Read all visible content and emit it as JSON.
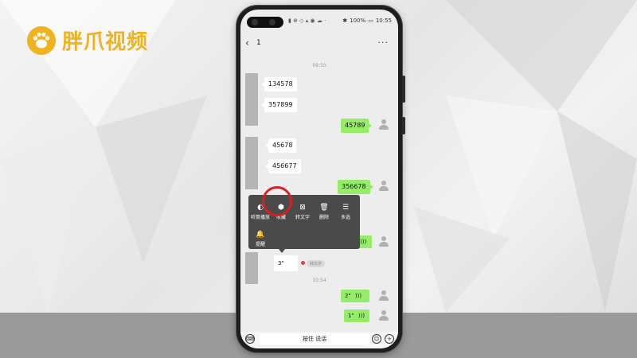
{
  "brand": {
    "name": "胖爪视频",
    "icon": "paw-icon",
    "color": "#f0b21e"
  },
  "status_bar": {
    "battery": "100%",
    "time": "10:55"
  },
  "chat": {
    "title": "1",
    "times": [
      "09:50",
      "10:54"
    ],
    "incoming": [
      "134578",
      "357899",
      "45678",
      "456677"
    ],
    "outgoing": [
      "45789",
      "356678"
    ],
    "voice_incoming": {
      "duration": "3\"",
      "tag": "转文字"
    },
    "voice_outgoing": [
      {
        "duration": "2\""
      },
      {
        "duration": "1\""
      }
    ]
  },
  "context_menu": {
    "items": [
      {
        "label": "听筒播放",
        "icon": "ear-icon"
      },
      {
        "label": "收藏",
        "icon": "cube-icon"
      },
      {
        "label": "转文字",
        "icon": "text-convert-icon"
      },
      {
        "label": "删除",
        "icon": "trash-icon"
      },
      {
        "label": "多选",
        "icon": "list-icon"
      },
      {
        "label": "提醒",
        "icon": "bell-icon"
      }
    ],
    "highlight_color": "#d81e1e"
  },
  "input_bar": {
    "hold_to_talk": "按住 说话"
  }
}
